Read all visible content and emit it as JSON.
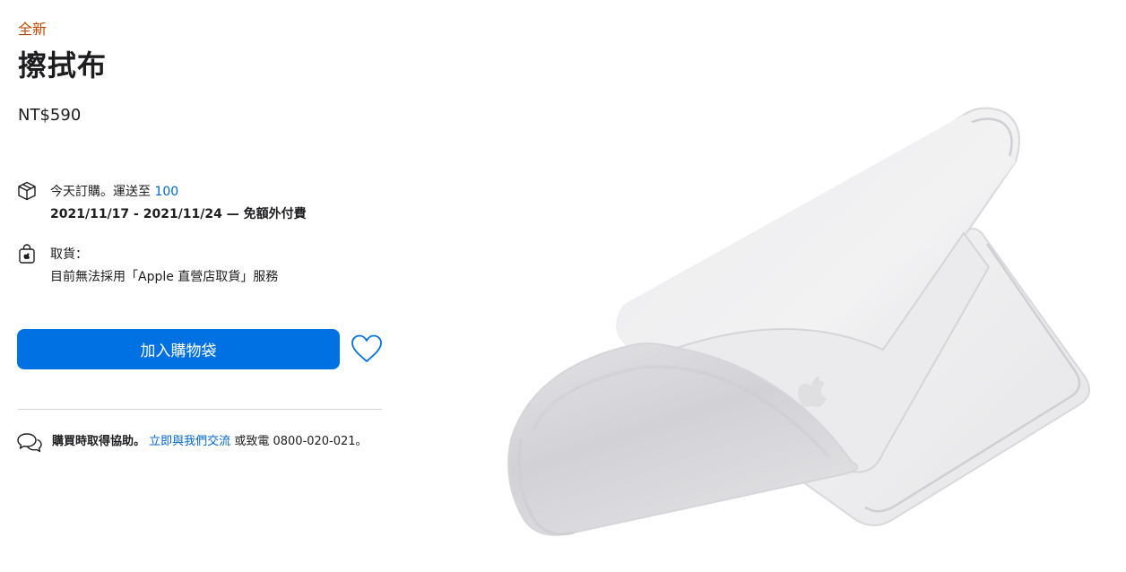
{
  "product": {
    "badge": "全新",
    "title": "擦拭布",
    "price": "NT$590"
  },
  "delivery": {
    "prefix": "今天訂購。運送至",
    "zip": "100",
    "dates": "2021/11/17 - 2021/11/24 — 免額外付費",
    "icon": "box-icon"
  },
  "pickup": {
    "label": "取貨：",
    "note": "目前無法採用「Apple 直營店取貨」服務",
    "icon": "store-bag-icon"
  },
  "actions": {
    "add_to_bag": "加入購物袋",
    "favorite_icon": "heart-icon"
  },
  "help": {
    "lead": "購買時取得協助。",
    "chat_link": "立即與我們交流",
    "or_call": "或致電",
    "phone": "0800-020-021。",
    "icon": "chat-bubbles-icon"
  },
  "colors": {
    "accent": "#0071e3",
    "link": "#0066cc",
    "badge": "#bf4800"
  }
}
